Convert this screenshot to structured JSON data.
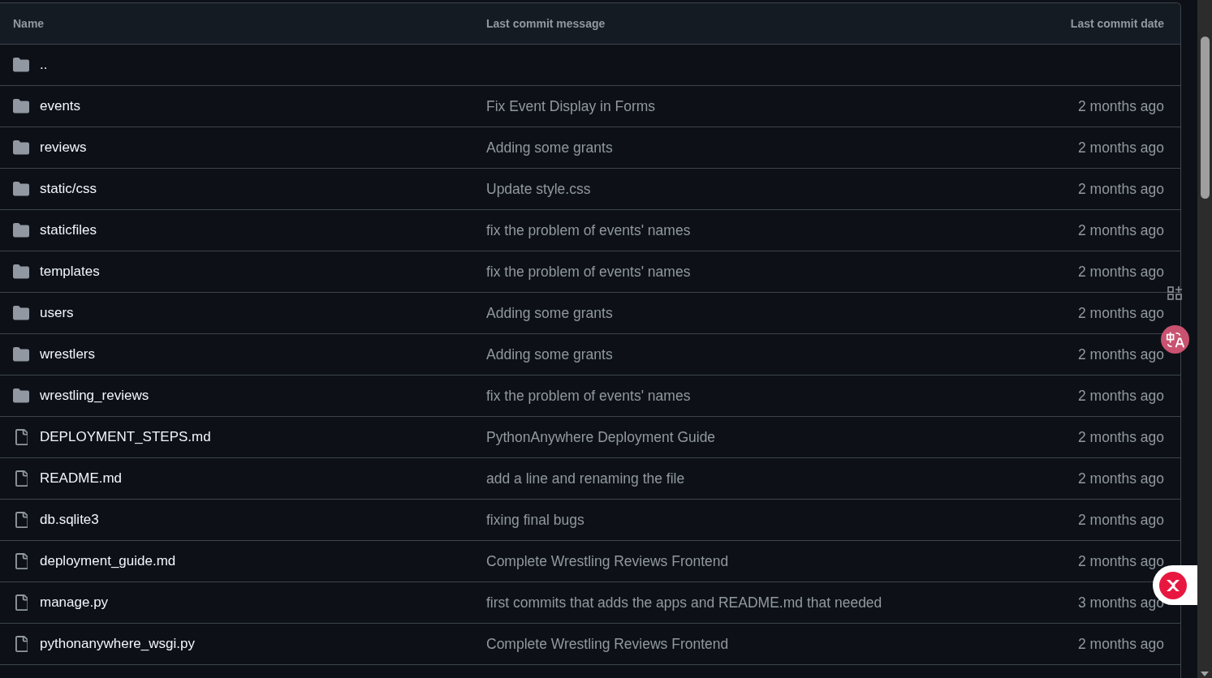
{
  "table": {
    "columns": [
      "Name",
      "Last commit message",
      "Last commit date"
    ],
    "rows": [
      {
        "kind": "folder",
        "name": ".."
      },
      {
        "kind": "folder",
        "name": "events",
        "message": "Fix Event Display in Forms",
        "date": "2 months ago"
      },
      {
        "kind": "folder",
        "name": "reviews",
        "message": "Adding some grants",
        "date": "2 months ago"
      },
      {
        "kind": "folder",
        "name": "static/css",
        "message": "Update style.css",
        "date": "2 months ago"
      },
      {
        "kind": "folder",
        "name": "staticfiles",
        "message": "fix the problem of events' names",
        "date": "2 months ago"
      },
      {
        "kind": "folder",
        "name": "templates",
        "message": "fix the problem of events' names",
        "date": "2 months ago"
      },
      {
        "kind": "folder",
        "name": "users",
        "message": "Adding some grants",
        "date": "2 months ago"
      },
      {
        "kind": "folder",
        "name": "wrestlers",
        "message": "Adding some grants",
        "date": "2 months ago"
      },
      {
        "kind": "folder",
        "name": "wrestling_reviews",
        "message": "fix the problem of events' names",
        "date": "2 months ago"
      },
      {
        "kind": "file",
        "name": "DEPLOYMENT_STEPS.md",
        "message": "PythonAnywhere Deployment Guide",
        "date": "2 months ago"
      },
      {
        "kind": "file",
        "name": "README.md",
        "message": "add a line and renaming the file",
        "date": "2 months ago"
      },
      {
        "kind": "file",
        "name": "db.sqlite3",
        "message": "fixing final bugs",
        "date": "2 months ago"
      },
      {
        "kind": "file",
        "name": "deployment_guide.md",
        "message": "Complete Wrestling Reviews Frontend",
        "date": "2 months ago"
      },
      {
        "kind": "file",
        "name": "manage.py",
        "message": "first commits that adds the apps and README.md that needed",
        "date": "3 months ago"
      },
      {
        "kind": "file",
        "name": "pythonanywhere_wsgi.py",
        "message": "Complete Wrestling Reviews Frontend",
        "date": "2 months ago"
      }
    ]
  }
}
